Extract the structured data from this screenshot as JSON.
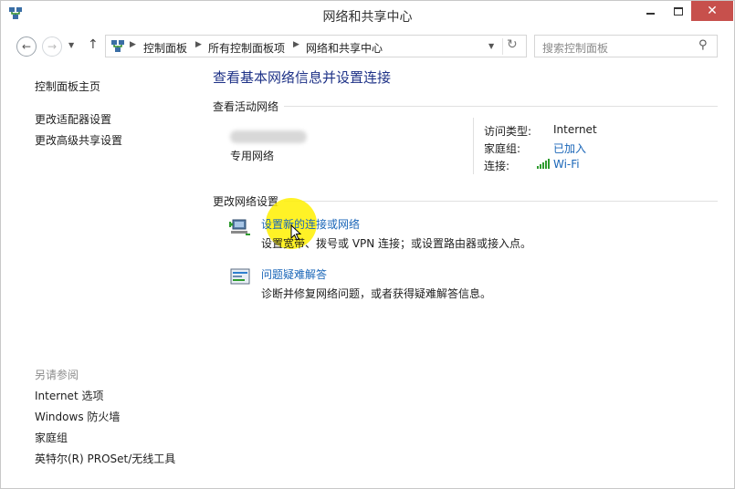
{
  "window": {
    "title": "网络和共享中心",
    "close_glyph": "✕"
  },
  "nav": {
    "back_glyph": "←",
    "forward_glyph": "→",
    "dropdown_glyph": "▼",
    "up_glyph": "↑",
    "breadcrumbs": [
      "控制面板",
      "所有控制面板项",
      "网络和共享中心"
    ],
    "separator": "▶",
    "refresh_glyph": "↻",
    "search_placeholder": "搜索控制面板",
    "search_glyph": "⚲"
  },
  "sidebar": {
    "home": "控制面板主页",
    "links": [
      "更改适配器设置",
      "更改高级共享设置"
    ],
    "see_also_heading": "另请参阅",
    "see_also": [
      "Internet 选项",
      "Windows 防火墙",
      "家庭组",
      "英特尔(R) PROSet/无线工具"
    ]
  },
  "main": {
    "title": "查看基本网络信息并设置连接",
    "active_networks_heading": "查看活动网络",
    "network_category": "专用网络",
    "properties": [
      {
        "key": "访问类型:",
        "value": "Internet",
        "is_link": false
      },
      {
        "key": "家庭组:",
        "value": "已加入",
        "is_link": true
      },
      {
        "key": "连接:",
        "value": "Wi-Fi",
        "is_link": true
      }
    ],
    "change_settings_heading": "更改网络设置",
    "tasks": [
      {
        "link": "设置新的连接或网络",
        "desc": "设置宽带、拨号或 VPN 连接；或设置路由器或接入点。",
        "icon": "network-setup-icon"
      },
      {
        "link": "问题疑难解答",
        "desc": "诊断并修复网络问题，或者获得疑难解答信息。",
        "icon": "troubleshoot-icon"
      }
    ]
  },
  "colors": {
    "link": "#1a66b8",
    "title_blue": "#1e3287",
    "close_red": "#c7504c",
    "highlight_yellow": "#fff000"
  }
}
